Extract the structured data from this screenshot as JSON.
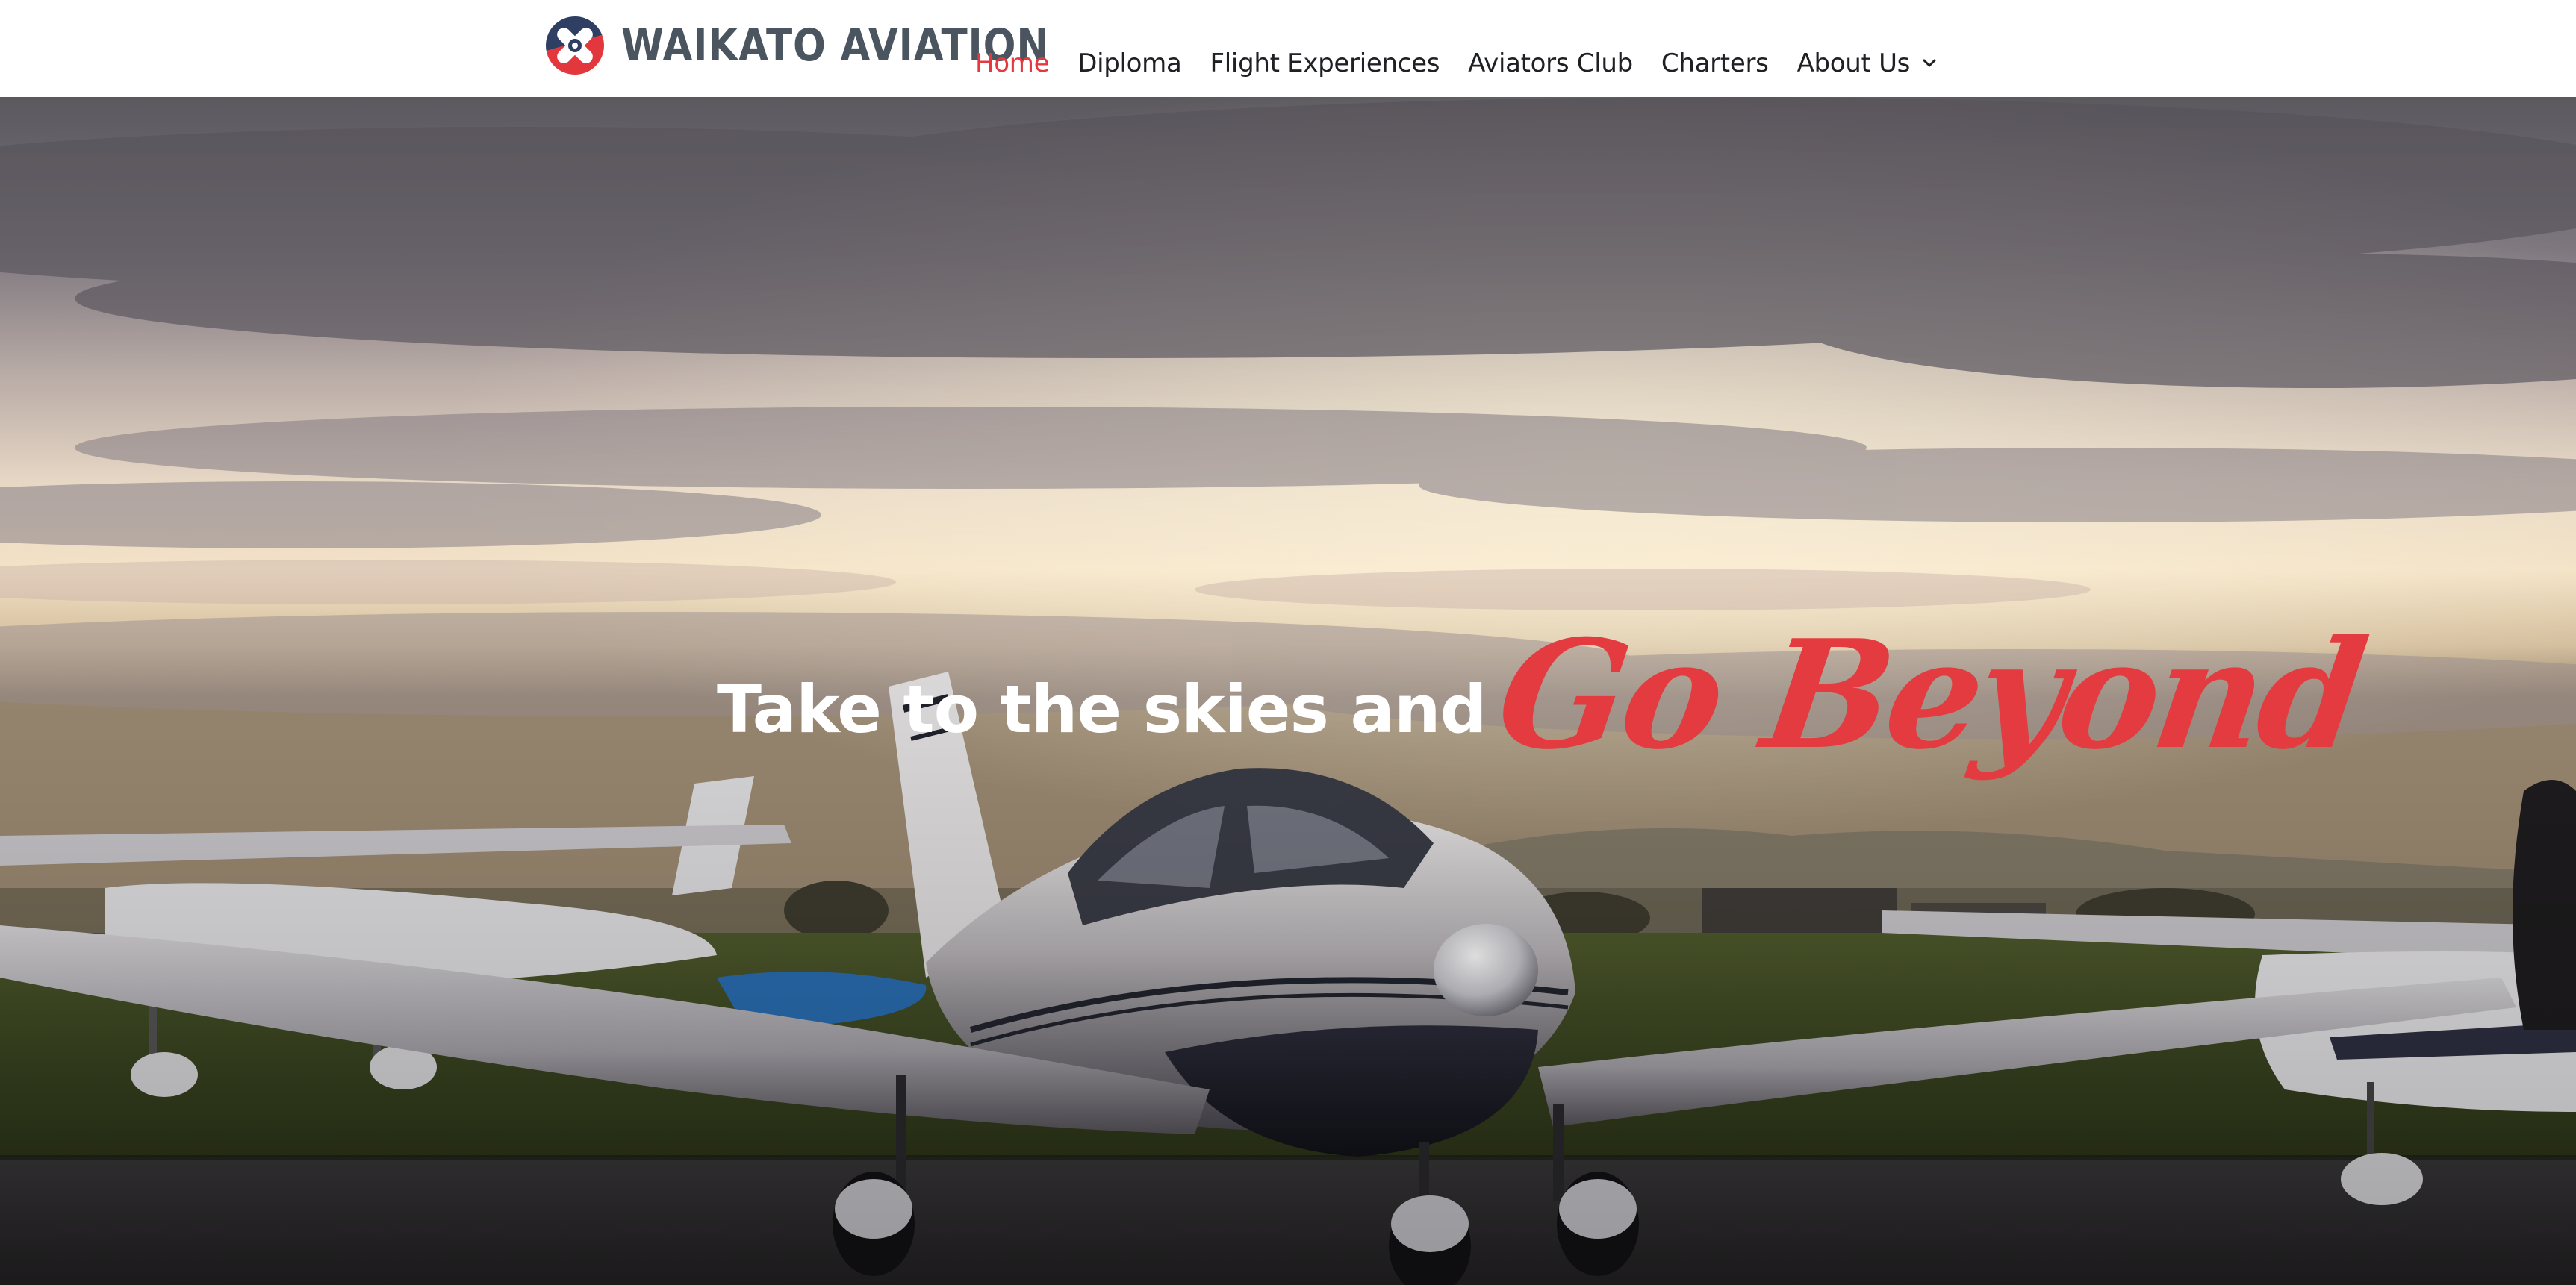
{
  "header": {
    "logo": {
      "icon": "propeller-roundel-icon",
      "text": "WAIKATO AVIATION"
    },
    "nav": {
      "items": [
        {
          "label": "Home",
          "active": true
        },
        {
          "label": "Diploma",
          "active": false
        },
        {
          "label": "Flight Experiences",
          "active": false
        },
        {
          "label": "Aviators Club",
          "active": false
        },
        {
          "label": "Charters",
          "active": false
        },
        {
          "label": "About Us",
          "active": false,
          "icon": "chevron-down-icon"
        }
      ]
    }
  },
  "hero": {
    "headline_lead": "Take to the skies and",
    "headline_accent": "Go Beyond"
  },
  "colors": {
    "accent_red": "#e23a3e",
    "logo_navy": "#2f3e63",
    "logo_grey": "#4b5560",
    "nav_text": "#1e2024"
  }
}
